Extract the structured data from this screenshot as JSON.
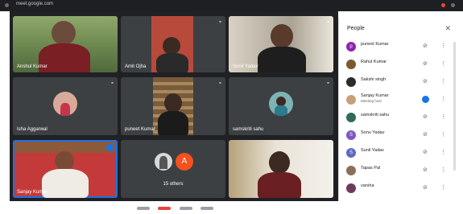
{
  "meeting": {
    "tabs_text": "meet.google.com",
    "tiles": [
      {
        "name": "Anshul Kumar"
      },
      {
        "name": "Amit Ojha"
      },
      {
        "name": "Sunil Yadav"
      },
      {
        "name": "Isha Aggarwal"
      },
      {
        "name": "puneet Kumar"
      },
      {
        "name": "samskriti sahu"
      },
      {
        "name": "Sanjay Kumar"
      },
      {
        "name": "15 others",
        "avatar_letter": "A"
      },
      {
        "name": ""
      }
    ]
  },
  "people_panel": {
    "title": "People",
    "participants": [
      {
        "name": "puneet Kumar",
        "initial": "p",
        "color": "#8e24aa"
      },
      {
        "name": "Rahul Kumar",
        "initial": "",
        "color": "#7a5a2e"
      },
      {
        "name": "Sakshi singh",
        "initial": "",
        "color": "#2b2b2b"
      },
      {
        "name": "Sanjay Kumar",
        "sub": "Meeting host",
        "initial": "",
        "color": "#c9a07a",
        "speaking": true
      },
      {
        "name": "samskriti sahu",
        "initial": "",
        "color": "#2f6a5b"
      },
      {
        "name": "Sonu Yadav",
        "initial": "S",
        "color": "#7e57c2"
      },
      {
        "name": "Sunil Yadav",
        "initial": "S",
        "color": "#5c6bc0"
      },
      {
        "name": "Tapas Pal",
        "initial": "",
        "color": "#8a6d5a"
      },
      {
        "name": "varsha",
        "initial": "",
        "color": "#6d3b5a"
      }
    ]
  },
  "colors": {
    "stage_bg": "#202124",
    "tile_bg": "#3c4043",
    "accent": "#1a73e8",
    "others_avatar": "#f4511e"
  }
}
